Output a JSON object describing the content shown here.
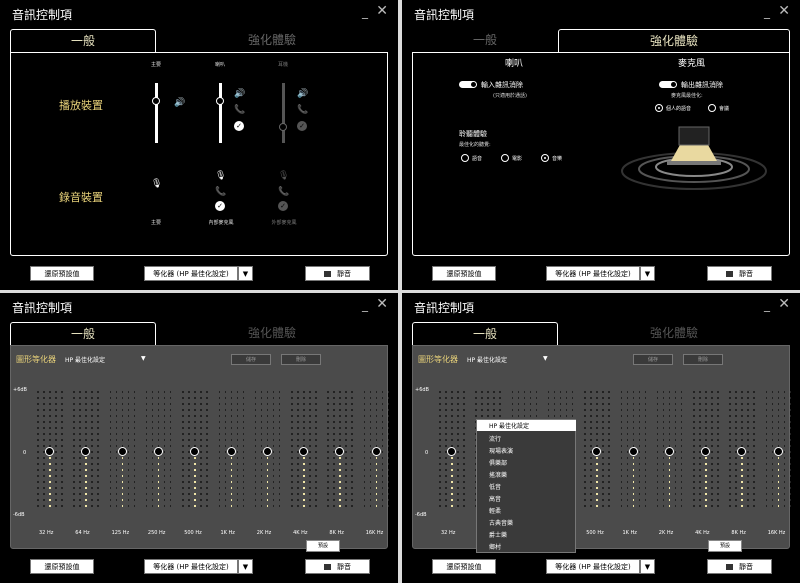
{
  "window_title": "音訊控制項",
  "tabs": {
    "general": "一般",
    "enhanced": "強化體驗"
  },
  "footer": {
    "restore": "還原預設值",
    "equalizer": "等化器 (HP 最佳化設定)",
    "mute": "靜音"
  },
  "general": {
    "playback_label": "播放裝置",
    "recording_label": "錄音裝置",
    "playback_devices": [
      "主要",
      "喇叭",
      "耳機"
    ],
    "recording_devices": [
      "主要",
      "內部麥克風",
      "外部麥克風"
    ]
  },
  "enhanced": {
    "speaker_header": "喇叭",
    "mic_header": "麥克風",
    "input_noise_cancel": "輸入雜訊消除",
    "input_noise_note": "(只適用於通話)",
    "output_noise_cancel": "輸出雜訊消除",
    "mic_optimize_for": "麥克風最佳化:",
    "mic_options": [
      "個人的語音",
      "會議"
    ],
    "listening_experience": "聆聽體驗",
    "optimize_for": "最佳化的聽覺:",
    "listen_options": [
      "語音",
      "電影",
      "音樂"
    ]
  },
  "equalizer": {
    "label": "圖形等化器",
    "preset": "HP 最佳化設定",
    "save": "儲存",
    "delete": "刪除",
    "reset": "預設",
    "db_max": "+6dB",
    "db_zero": "0",
    "db_min": "-6dB",
    "frequencies": [
      "32 Hz",
      "64 Hz",
      "125 Hz",
      "250 Hz",
      "500 Hz",
      "1K Hz",
      "2K Hz",
      "4K Hz",
      "8K Hz",
      "16K Hz"
    ],
    "presets": [
      "HP 最佳化設定",
      "流行",
      "現場表演",
      "俱樂部",
      "搖滾樂",
      "低音",
      "高音",
      "輕柔",
      "古典音樂",
      "爵士樂",
      "鄉村"
    ]
  },
  "icons": [
    "minimize-icon",
    "close-icon",
    "speaker-icon",
    "phone-icon",
    "mic-icon",
    "check-icon",
    "windows-icon",
    "dropdown-arrow-icon"
  ]
}
